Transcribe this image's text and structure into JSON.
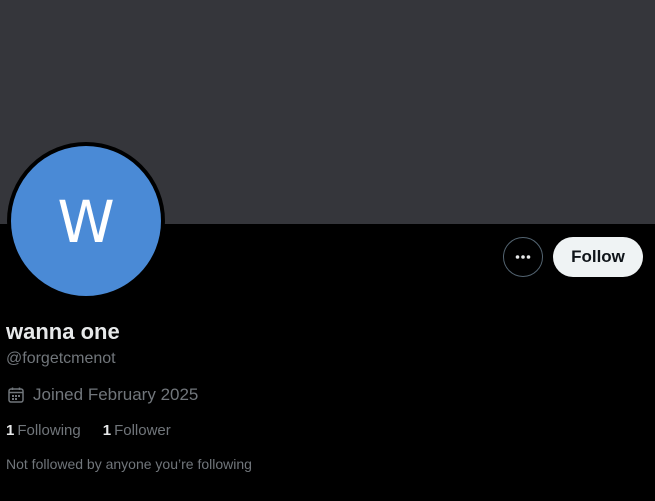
{
  "profile": {
    "avatar_letter": "W",
    "display_name": "wanna one",
    "handle": "@forgetcmenot",
    "joined": "Joined February 2025",
    "following_count": "1",
    "following_label": "Following",
    "follower_count": "1",
    "follower_label": "Follower",
    "followed_by_note": "Not followed by anyone you’re following"
  },
  "actions": {
    "follow_label": "Follow",
    "more_icon": "more-horizontal-icon"
  },
  "colors": {
    "banner": "#35363b",
    "avatar_bg": "#4a8ad6",
    "background": "#000000",
    "follow_button_bg": "#eff3f4",
    "secondary_text": "#71767b",
    "primary_text": "#e7e9ea"
  },
  "icons": {
    "joined": "calendar-icon"
  }
}
